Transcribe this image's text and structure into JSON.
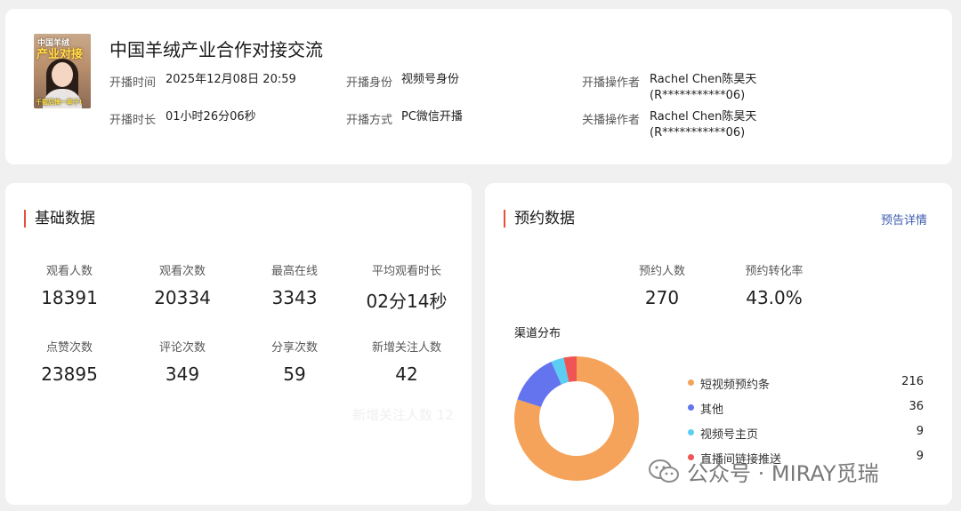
{
  "header": {
    "cover": {
      "line1": "中国羊绒",
      "line2": "产业对接",
      "line3": "千载后悔一辈子!"
    },
    "title": "中国羊绒产业合作对接交流",
    "fields": {
      "start_time_label": "开播时间",
      "start_time_value": "2025年12月08日 20:59",
      "duration_label": "开播时长",
      "duration_value": "01小时26分06秒",
      "identity_label": "开播身份",
      "identity_value": "视频号身份",
      "method_label": "开播方式",
      "method_value": "PC微信开播",
      "start_operator_label": "开播操作者",
      "start_operator_name": "Rachel Chen陈昊天",
      "start_operator_id": "(R***********06)",
      "end_operator_label": "关播操作者",
      "end_operator_name": "Rachel Chen陈昊天",
      "end_operator_id": "(R***********06)"
    }
  },
  "basic": {
    "title": "基础数据",
    "stats": [
      {
        "label": "观看人数",
        "value": "18391"
      },
      {
        "label": "观看次数",
        "value": "20334"
      },
      {
        "label": "最高在线",
        "value": "3343"
      },
      {
        "label": "平均观看时长",
        "value": "02分14秒"
      },
      {
        "label": "点赞次数",
        "value": "23895"
      },
      {
        "label": "评论次数",
        "value": "349"
      },
      {
        "label": "分享次数",
        "value": "59"
      },
      {
        "label": "新增关注人数",
        "value": "42"
      }
    ],
    "ghost_text": "新增关注人数  12"
  },
  "reservation": {
    "title": "预约数据",
    "detail_link": "预告详情",
    "stats": [
      {
        "label": "预约人数",
        "value": "270"
      },
      {
        "label": "预约转化率",
        "value": "43.0%"
      }
    ],
    "channel_title": "渠道分布"
  },
  "chart_data": {
    "type": "pie",
    "donut": true,
    "series": [
      {
        "name": "短视频预约条",
        "value": 216,
        "color": "#f5a35a"
      },
      {
        "name": "其他",
        "value": 36,
        "color": "#6473ee"
      },
      {
        "name": "视频号主页",
        "value": 9,
        "color": "#5ccdf3"
      },
      {
        "name": "直播间链接推送",
        "value": 9,
        "color": "#f05454"
      }
    ]
  },
  "watermark": {
    "text": "公众号 · MIRAY觅瑞",
    "icon": "wechat-icon"
  }
}
